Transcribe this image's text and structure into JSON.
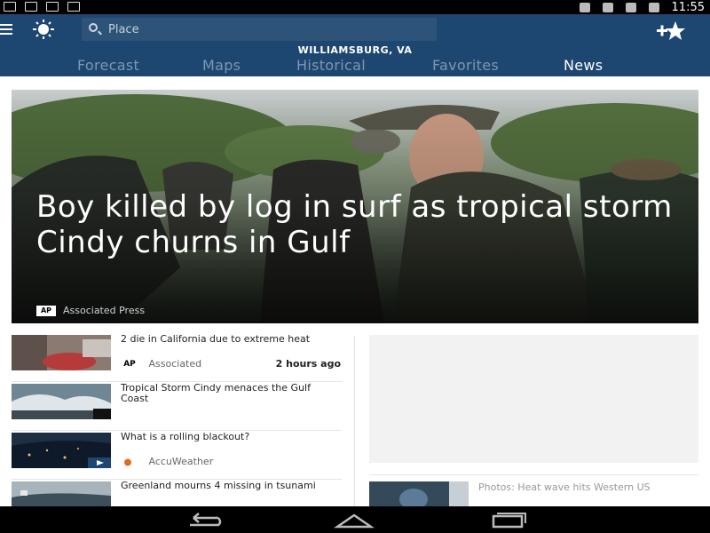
{
  "status_bar": {
    "time": "11:55"
  },
  "header": {
    "search": {
      "placeholder": "Place",
      "value": ""
    },
    "location": "WILLIAMSBURG, VA",
    "tabs": [
      {
        "label": "Forecast",
        "active": false
      },
      {
        "label": "Maps",
        "active": false
      },
      {
        "label": "Historical",
        "active": false
      },
      {
        "label": "Favorites",
        "active": false
      },
      {
        "label": "News",
        "active": true
      }
    ],
    "accent_color": "#1d4670"
  },
  "hero": {
    "title": "Boy killed by log in surf as tropical storm Cindy churns in Gulf",
    "source_logo": "AP",
    "source": "Associated Press"
  },
  "articles": [
    {
      "headline": "2 die in California due to extreme heat",
      "source_logo": "AP",
      "source": "Associated",
      "time": "2 hours ago"
    },
    {
      "headline": "Tropical Storm Cindy menaces the Gulf Coast",
      "source": "",
      "time": ""
    },
    {
      "headline": "What is a rolling blackout?",
      "source": "AccuWeather",
      "time": ""
    },
    {
      "headline": "Greenland mourns 4 missing in tsunami",
      "source": "",
      "time": ""
    }
  ],
  "side_card": {
    "title": "Photos: Heat wave hits Western US"
  }
}
